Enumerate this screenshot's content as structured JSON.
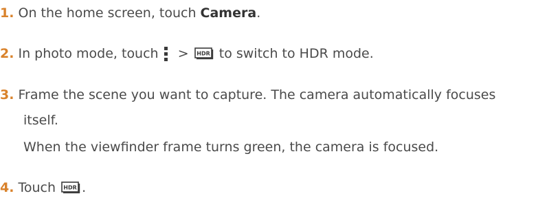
{
  "steps": [
    {
      "number": "1.",
      "text_before": "On the home screen, touch ",
      "bold": "Camera",
      "text_after": "."
    },
    {
      "number": "2.",
      "text_before": "In photo mode, touch",
      "separator": ">",
      "text_after": "to switch to HDR mode.",
      "menu_icon": "more-vertical-icon",
      "hdr_icon": "hdr-icon",
      "hdr_icon_text": "HDR"
    },
    {
      "number": "3.",
      "line1": "Frame the scene you want to capture. The camera automatically focuses",
      "line2": "itself.",
      "note": "When the viewfinder frame turns green, the camera is focused."
    },
    {
      "number": "4.",
      "text_before": "Touch",
      "text_after": ".",
      "hdr_icon": "hdr-icon",
      "hdr_icon_text": "HDR"
    }
  ],
  "colors": {
    "step_number": "#d9822b",
    "body_text": "#4a4a4a",
    "icon": "#3a3a3a"
  }
}
